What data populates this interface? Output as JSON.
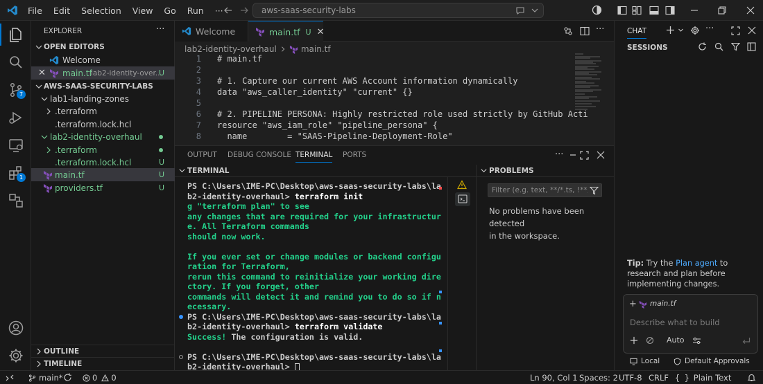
{
  "titlebar": {
    "menus": [
      "File",
      "Edit",
      "Selection",
      "View",
      "Go",
      "Run"
    ],
    "more_icon": "ellipsis-icon",
    "search_text": "aws-saas-security-labs"
  },
  "activity_badges": {
    "scm": "7",
    "extensions": "1"
  },
  "explorer": {
    "title": "EXPLORER",
    "open_editors_label": "OPEN EDITORS",
    "open_editors": [
      {
        "name": "Welcome"
      },
      {
        "name": "main.tf",
        "path": "lab2-identity-over...",
        "status": "U"
      }
    ],
    "workspace_label": "AWS-SAAS-SECURITY-LABS",
    "tree": [
      {
        "name": "lab1-landing-zones"
      },
      {
        "name": ".terraform"
      },
      {
        "name": ".terraform.lock.hcl"
      },
      {
        "name": "lab2-identity-overhaul"
      },
      {
        "name": ".terraform"
      },
      {
        "name": ".terraform.lock.hcl",
        "status": "U"
      },
      {
        "name": "main.tf",
        "status": "U"
      },
      {
        "name": "providers.tf",
        "status": "U"
      }
    ],
    "outline_label": "OUTLINE",
    "timeline_label": "TIMELINE"
  },
  "editor": {
    "tabs": [
      {
        "label": "Welcome"
      },
      {
        "label": "main.tf",
        "status": "U"
      }
    ],
    "breadcrumb": {
      "folder": "lab2-identity-overhaul",
      "file": "main.tf"
    },
    "lines": [
      {
        "n": "1",
        "text": "# main.tf"
      },
      {
        "n": "2",
        "text": ""
      },
      {
        "n": "3",
        "text": "# 1. Capture our current AWS Account information dynamically"
      },
      {
        "n": "4",
        "text": "data \"aws_caller_identity\" \"current\" {}"
      },
      {
        "n": "5",
        "text": ""
      },
      {
        "n": "6",
        "text": "# 2. PIPELINE PERSONA: Highly restricted role used strictly by GitHub Acti"
      },
      {
        "n": "7",
        "text": "resource \"aws_iam_role\" \"pipeline_persona\" {"
      },
      {
        "n": "8",
        "text": "  name        = \"SAAS-Pipeline-Deployment-Role\""
      }
    ]
  },
  "panel": {
    "tabs": [
      "OUTPUT",
      "DEBUG CONSOLE",
      "TERMINAL",
      "PORTS"
    ],
    "terminal_label": "TERMINAL",
    "problems_label": "PROBLEMS",
    "filter_placeholder": "Filter (e.g. text, **/*.ts, !**/...",
    "problems_message_1": "No problems have been detected",
    "problems_message_2": "in the workspace.",
    "terminal_lines": [
      {
        "text": "PS C:\\Users\\IME-PC\\Desktop\\aws-saas-security-labs\\la",
        "color": "white"
      },
      {
        "text": "b2-identity-overhaul> ",
        "cmd": "terraform init",
        "color": "white"
      },
      {
        "text": "g \"terraform plan\" to see",
        "color": "green"
      },
      {
        "text": "any changes that are required for your infrastructur",
        "color": "green"
      },
      {
        "text": "e. All Terraform commands",
        "color": "green"
      },
      {
        "text": "should now work.",
        "color": "green"
      },
      {
        "text": "",
        "color": "green"
      },
      {
        "text": "If you ever set or change modules or backend configu",
        "color": "green"
      },
      {
        "text": "ration for Terraform,",
        "color": "green"
      },
      {
        "text": "rerun this command to reinitialize your working dire",
        "color": "green"
      },
      {
        "text": "ctory. If you forget, other",
        "color": "green"
      },
      {
        "text": "commands will detect it and remind you to do so if n",
        "color": "green"
      },
      {
        "text": "ecessary.",
        "color": "green"
      },
      {
        "text": "PS C:\\Users\\IME-PC\\Desktop\\aws-saas-security-labs\\la",
        "color": "white"
      },
      {
        "text": "b2-identity-overhaul> ",
        "cmd": "terraform validate",
        "color": "white"
      },
      {
        "text": "Success!",
        "rest": " The configuration is valid.",
        "color": "green"
      },
      {
        "text": "",
        "color": "white"
      },
      {
        "text": "PS C:\\Users\\IME-PC\\Desktop\\aws-saas-security-labs\\la",
        "color": "white"
      },
      {
        "text": "b2-identity-overhaul> ",
        "color": "white"
      }
    ]
  },
  "chat": {
    "title": "CHAT",
    "sessions_label": "SESSIONS",
    "tip_bold": "Tip:",
    "tip_pre": " Try the ",
    "tip_link": "Plan agent",
    "tip_post": " to research and plan before implementing changes.",
    "context_file": "main.tf",
    "input_placeholder": "Describe what to build",
    "mode_label": "Auto",
    "local_label": "Local",
    "approvals_label": "Default Approvals"
  },
  "statusbar": {
    "branch": "main*",
    "errors": "0",
    "warnings": "0",
    "position": "Ln 90, Col 1",
    "spaces": "Spaces: 2",
    "encoding": "UTF-8",
    "eol": "CRLF",
    "language": "Plain Text"
  },
  "colors": {
    "accent": "#0078d4",
    "git_untracked": "#73c991",
    "terminal_green": "#23d18b",
    "terraform": "#844fba"
  }
}
